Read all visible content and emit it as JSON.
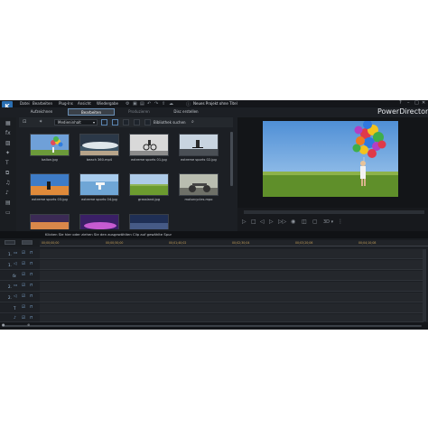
{
  "menu": {
    "items": [
      "Datei",
      "Bearbeiten",
      "Plug-Ins",
      "Ansicht",
      "Wiedergabe"
    ],
    "project_title": "Neues Projekt ohne Titel"
  },
  "modes": {
    "tabs": [
      "Aufzeichnen",
      "Bearbeiten",
      "Produzieren",
      "Disc erstellen"
    ],
    "active": "Bearbeiten"
  },
  "brand": "PowerDirector",
  "library": {
    "dropdown_value": "Medieninhalt",
    "search_label": "Bibliothek suchen",
    "items": [
      {
        "label": "ballon.jpg"
      },
      {
        "label": "beach 360.mp4"
      },
      {
        "label": "extreme sports 01.jpg"
      },
      {
        "label": "extreme sports 02.jpg"
      },
      {
        "label": "extreme sports 03.jpg"
      },
      {
        "label": "extreme sports 04.jpg"
      },
      {
        "label": "grassland.jpg"
      },
      {
        "label": "motorcycles.mpo"
      },
      {
        "label": ""
      },
      {
        "label": ""
      },
      {
        "label": ""
      }
    ]
  },
  "timeline": {
    "hint": "Klicken Sie hier oder ziehen Sie den ausgewählten Clip auf gewählte Spur",
    "ruler_ticks": [
      "00;00;00;00",
      "00;00;50;00",
      "00;01;40;02",
      "00;02;30;04",
      "00;03;20;06",
      "00;04;10;08"
    ],
    "tracks": [
      {
        "label": "1.",
        "icon": "video-track-icon"
      },
      {
        "label": "1.",
        "icon": "audio-track-icon"
      },
      {
        "label": "fx",
        "icon": "fx-track-icon"
      },
      {
        "label": "2.",
        "icon": "video-track-icon"
      },
      {
        "label": "2.",
        "icon": "audio-track-icon"
      },
      {
        "label": "T",
        "icon": "title-track-icon"
      },
      {
        "label": "",
        "icon": "voice-track-icon"
      }
    ],
    "scale_label": "",
    "head_buttons": [
      "",
      ""
    ]
  },
  "colors": {
    "accent": "#5b85b1",
    "timecode": "#c6a05a",
    "background": "#1c1f24"
  }
}
